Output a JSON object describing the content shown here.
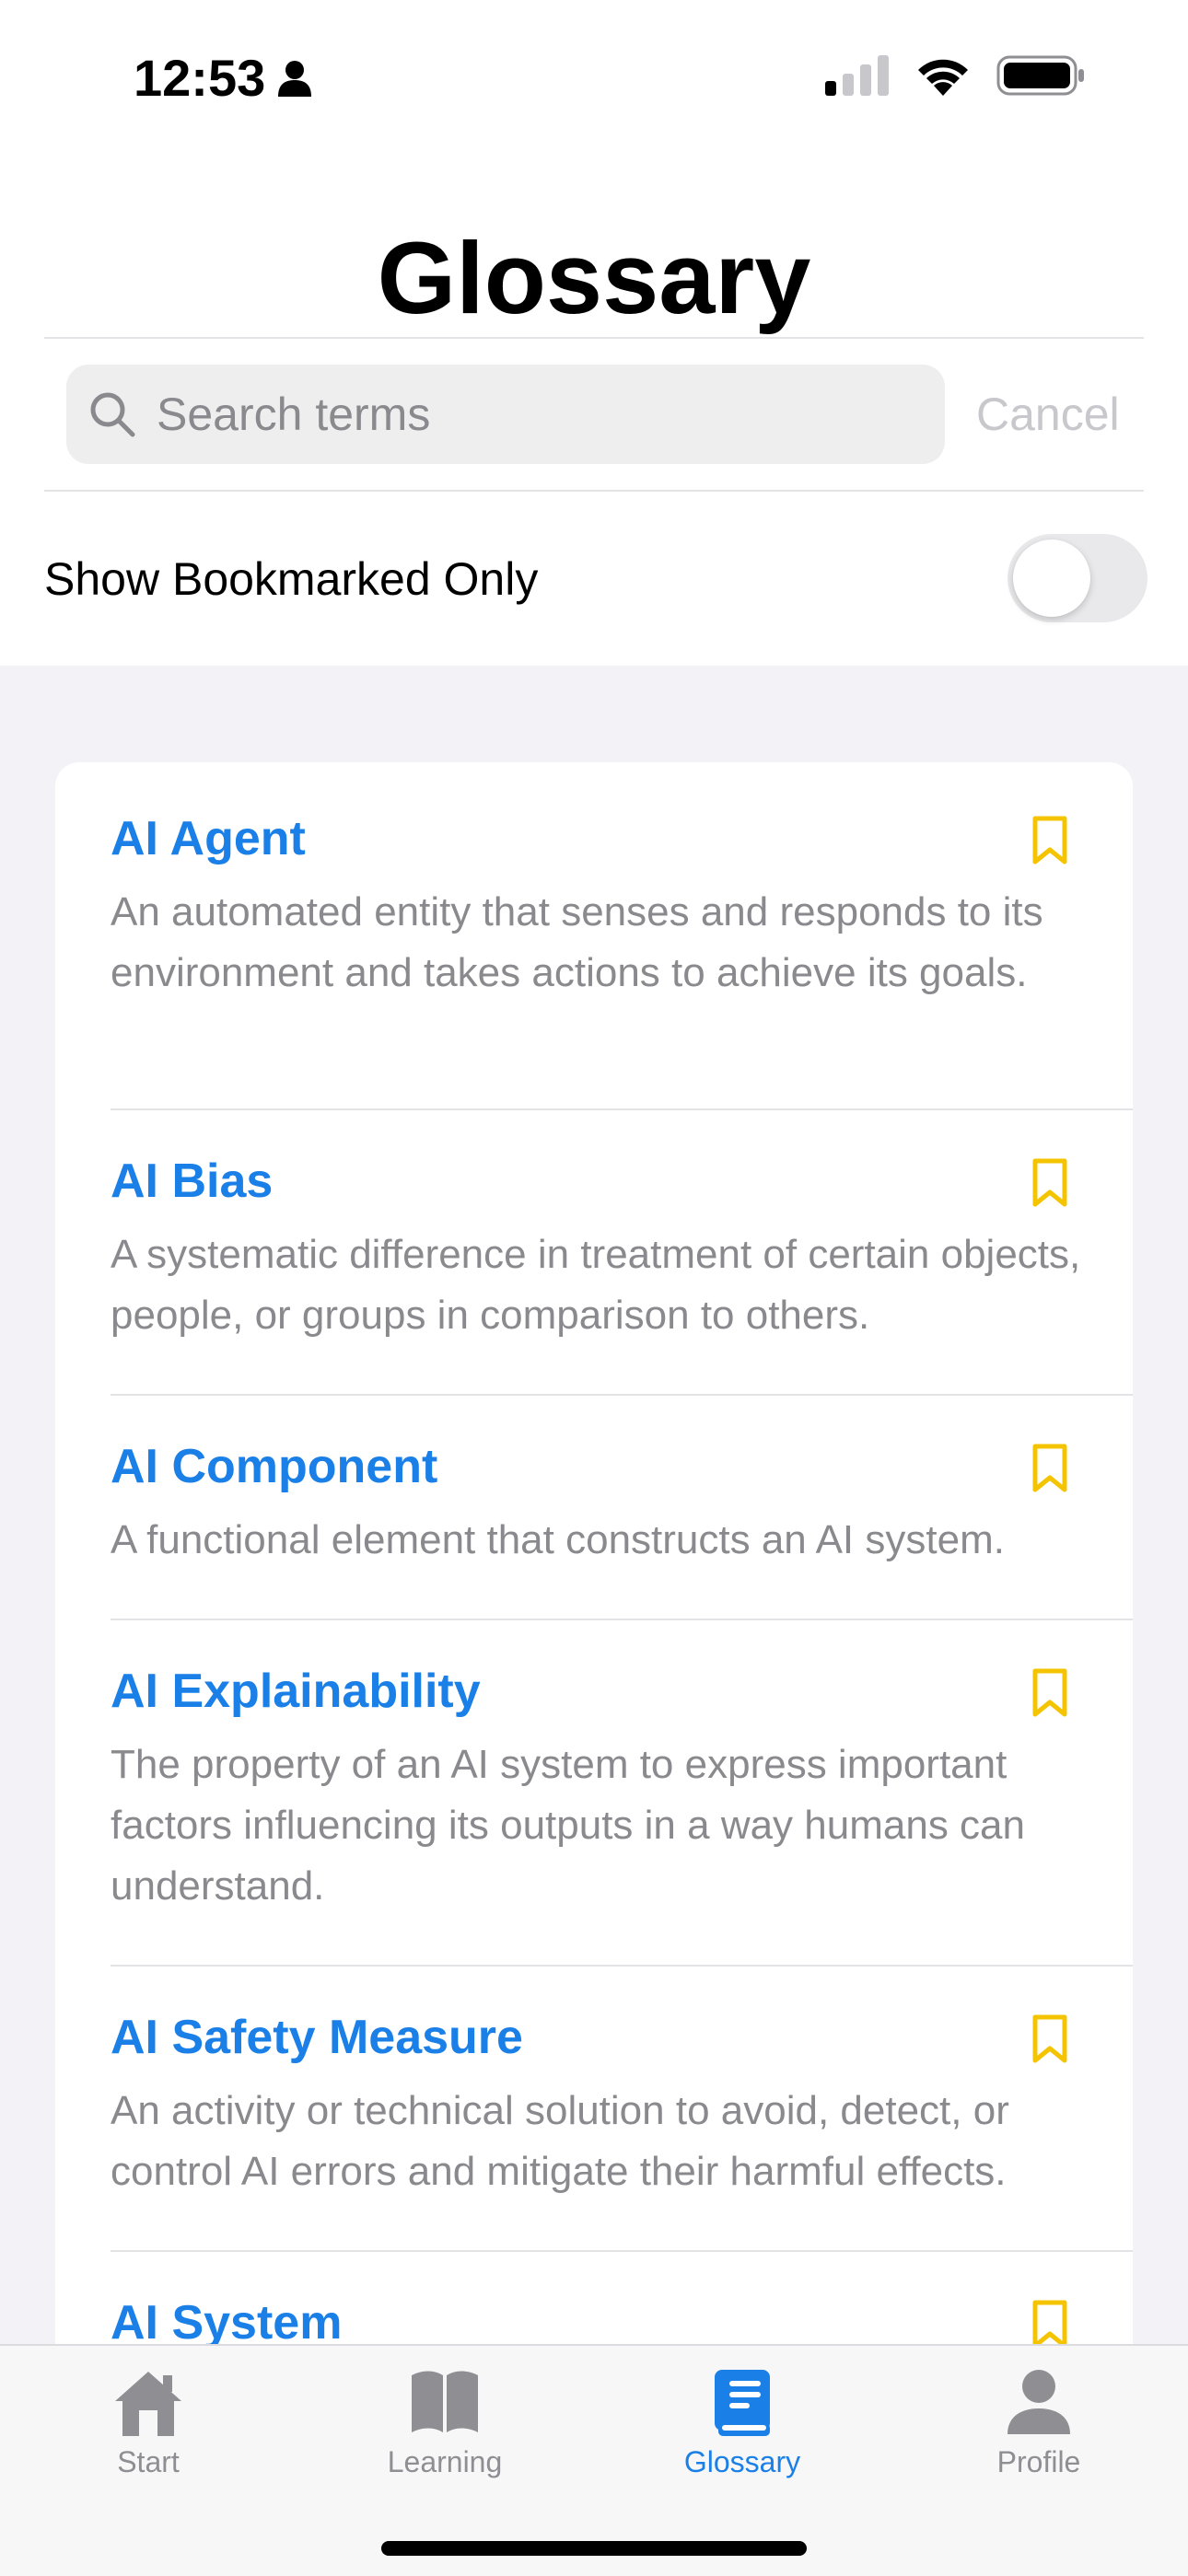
{
  "status_bar": {
    "time": "12:53"
  },
  "header": {
    "title": "Glossary"
  },
  "search": {
    "placeholder": "Search terms",
    "value": "",
    "cancel_label": "Cancel"
  },
  "filter": {
    "label": "Show Bookmarked Only",
    "enabled": false
  },
  "glossary": {
    "items": [
      {
        "term": "AI Agent",
        "definition": "An automated entity that senses and responds to its environment and takes actions to achieve its goals.",
        "bookmarked": false
      },
      {
        "term": "AI Bias",
        "definition": "A systematic difference in treatment of certain objects, people, or groups in comparison to others.",
        "bookmarked": false
      },
      {
        "term": "AI Component",
        "definition": "A functional element that constructs an AI system.",
        "bookmarked": false
      },
      {
        "term": "AI Explainability",
        "definition": "The property of an AI system to express important factors influencing its outputs in a way humans can understand.",
        "bookmarked": false
      },
      {
        "term": "AI Safety Measure",
        "definition": "An activity or technical solution to avoid, detect, or control AI errors and mitigate their harmful effects.",
        "bookmarked": false
      },
      {
        "term": "AI System",
        "definition": "",
        "bookmarked": false
      }
    ]
  },
  "tab_bar": {
    "tabs": [
      {
        "label": "Start",
        "icon": "house-icon",
        "active": false
      },
      {
        "label": "Learning",
        "icon": "book-open-icon",
        "active": false
      },
      {
        "label": "Glossary",
        "icon": "book-icon",
        "active": true
      },
      {
        "label": "Profile",
        "icon": "person-icon",
        "active": false
      }
    ]
  },
  "colors": {
    "accent": "#1a7fe6",
    "bookmark": "#f5c400",
    "secondary_text": "#8a8a8e"
  }
}
